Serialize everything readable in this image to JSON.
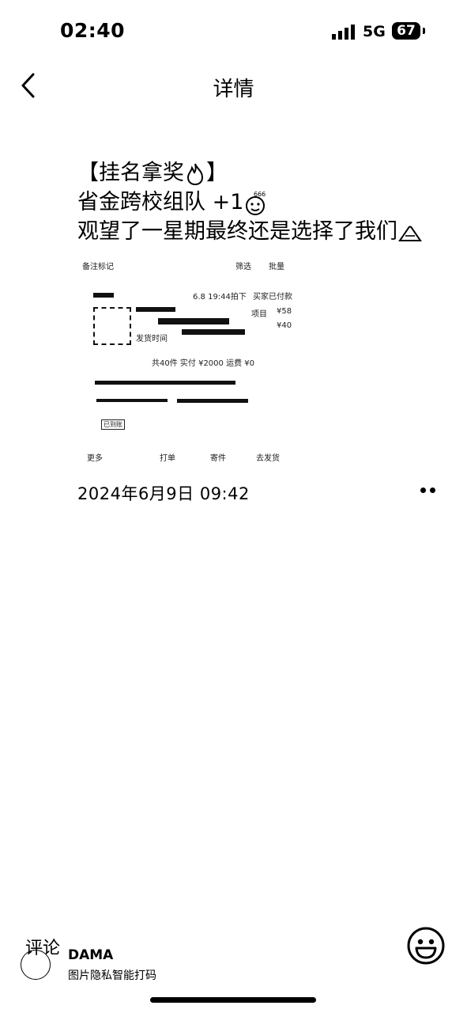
{
  "status_bar": {
    "time": "02:40",
    "network": "5G",
    "battery": "67"
  },
  "nav": {
    "title": "详情"
  },
  "post": {
    "line1": "【挂名拿奖",
    "line1_end": "】",
    "line2": "省金跨校组队 +1",
    "line3": "观望了一星期最终还是选择了我们"
  },
  "shot": {
    "remark": "备注标记",
    "filter": "筛选",
    "batch": "批量",
    "order_time": "6.8 19:44拍下",
    "order_status": "买家已付款",
    "item": "项目",
    "price1": "¥58",
    "price2": "¥40",
    "ship_time": "发货时间",
    "totals": "共40件  实付 ¥2000  运费 ¥0",
    "tag": "已到账",
    "btn_more": "更多",
    "btn_print": "打单",
    "btn_send": "寄件",
    "btn_ship": "去发货"
  },
  "date": "2024年6月9日 09:42",
  "footer": {
    "comment": "评论",
    "wm_title": "DAMA",
    "wm_sub": "图片隐私智能打码"
  }
}
